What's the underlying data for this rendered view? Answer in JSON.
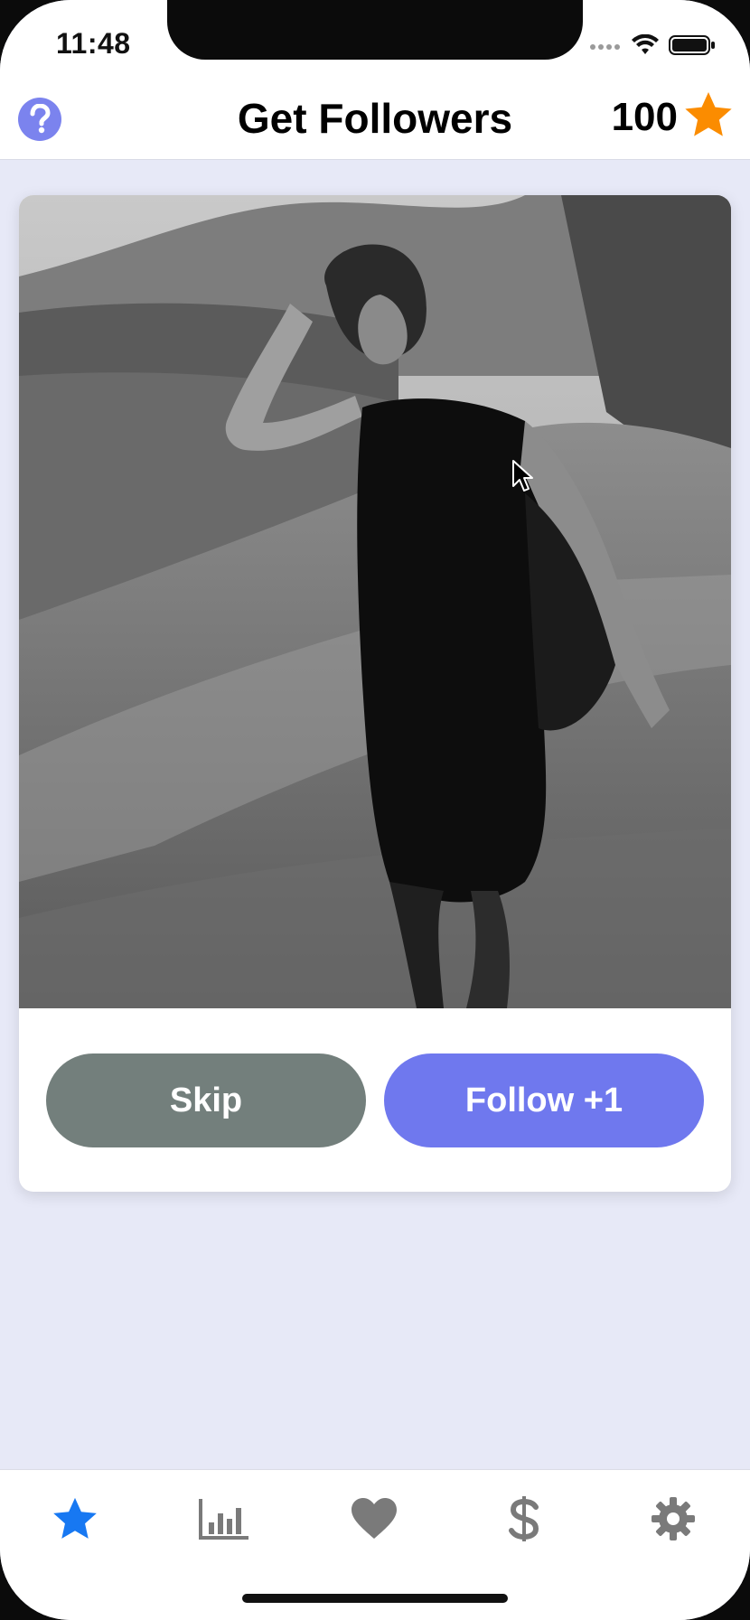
{
  "status_bar": {
    "time": "11:48"
  },
  "header": {
    "title": "Get Followers",
    "coins": "100",
    "help_icon": "question-circle-icon",
    "coin_icon": "star-icon"
  },
  "card": {
    "photo_description": "black-and-white photo of woman walking on dirt road",
    "skip_label": "Skip",
    "follow_label": "Follow +1"
  },
  "tabs": [
    {
      "icon": "star-icon",
      "active": true
    },
    {
      "icon": "bar-chart-icon",
      "active": false
    },
    {
      "icon": "heart-icon",
      "active": false
    },
    {
      "icon": "dollar-icon",
      "active": false
    },
    {
      "icon": "gear-icon",
      "active": false
    }
  ],
  "colors": {
    "accent": "#6f78ee",
    "skip": "#737f7c",
    "star": "#fb8c00",
    "active_tab": "#1778f2",
    "inactive_tab": "#7a7a7a",
    "background": "#e7e9f7"
  }
}
